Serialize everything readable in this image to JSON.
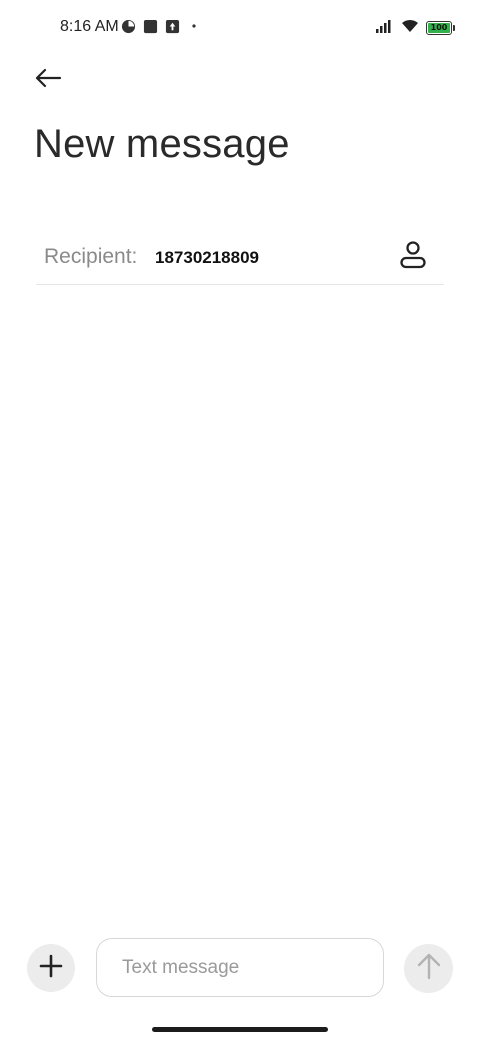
{
  "status_bar": {
    "time": "8:16 AM",
    "left_icons": [
      "pie-chart-icon",
      "square-app-icon",
      "upload-app-icon",
      "dot-icon"
    ],
    "right_icons": [
      "signal-icon",
      "wifi-icon",
      "battery-icon"
    ],
    "battery_level": "100",
    "battery_color": "#2fb34a"
  },
  "header": {
    "back_icon": "back-arrow-icon",
    "title": "New message"
  },
  "recipient": {
    "label": "Recipient:",
    "value": "18730218809",
    "contact_icon": "person-icon"
  },
  "composer": {
    "add_icon": "plus-icon",
    "placeholder": "Text message",
    "value": "",
    "send_icon": "send-arrow-icon"
  }
}
